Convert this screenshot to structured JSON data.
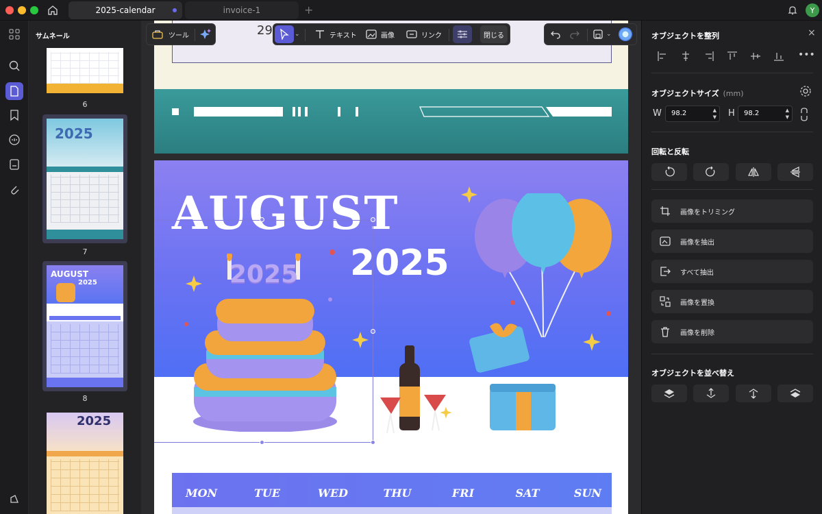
{
  "tabs": [
    {
      "label": "2025-calendar",
      "active": true
    },
    {
      "label": "invoice-1",
      "active": false
    }
  ],
  "user_avatar": "Y",
  "thumbnails_title": "サムネール",
  "thumbnails": [
    {
      "num": "6"
    },
    {
      "num": "7"
    },
    {
      "num": "8"
    }
  ],
  "toolbar": {
    "tools_label": "ツール",
    "text_label": "テキスト",
    "image_label": "画像",
    "link_label": "リンク",
    "close_label": "閉じる"
  },
  "page": {
    "month": "AUGUST",
    "year": "2025",
    "cake_text": "2025",
    "top_number": "29",
    "days": [
      "MON",
      "TUE",
      "WED",
      "THU",
      "FRI",
      "SAT",
      "SUN"
    ],
    "thumb8_month": "AUGUST",
    "thumb8_year": "2025",
    "thumb7_year": "2025",
    "thumb9_year": "2025"
  },
  "panel": {
    "align_title": "オブジェクトを整列",
    "size_title": "オブジェクトサイズ",
    "size_unit": "(mm)",
    "w_label": "W",
    "w_value": "98.2",
    "h_label": "H",
    "h_value": "98.2",
    "rotate_title": "回転と反転",
    "actions": [
      {
        "label": "画像をトリミング",
        "icon": "crop-icon"
      },
      {
        "label": "画像を抽出",
        "icon": "extract-image-icon"
      },
      {
        "label": "すべて抽出",
        "icon": "extract-all-icon"
      },
      {
        "label": "画像を置換",
        "icon": "replace-icon"
      },
      {
        "label": "画像を削除",
        "icon": "trash-icon"
      }
    ],
    "arrange_title": "オブジェクトを並べ替え"
  },
  "colors": {
    "accent": "#5b5bd6",
    "page_banner_top": "#8b7ff0",
    "page_banner_bottom": "#4f6ff5",
    "teal": "#3a9a9a",
    "cream": "#f7f3e3"
  }
}
